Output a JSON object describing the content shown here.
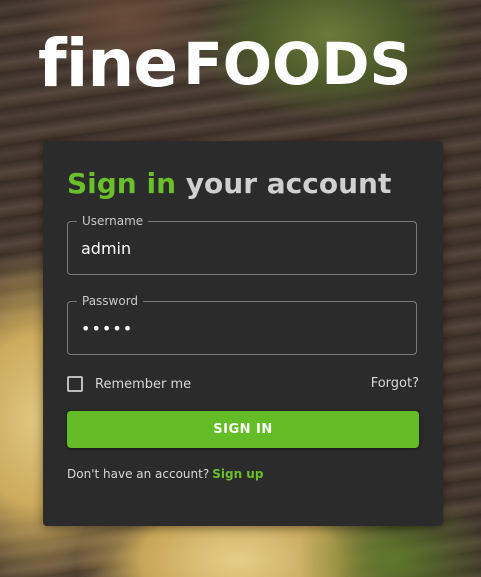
{
  "brand": {
    "logo_part1": "fine",
    "logo_part2": "FOODS"
  },
  "login": {
    "title_highlight": "Sign in",
    "title_rest": "your account",
    "username_label": "Username",
    "username_value": "admin",
    "password_label": "Password",
    "password_value": "•••••",
    "remember_label": "Remember me",
    "remember_checked": false,
    "forgot_label": "Forgot?",
    "signin_label": "SIGN IN",
    "no_account_text": "Don't have an account?",
    "signup_label": "Sign up"
  },
  "colors": {
    "accent": "#64bd26",
    "card_bg": "#2b2b2b",
    "title_muted": "#d0d0d0"
  }
}
